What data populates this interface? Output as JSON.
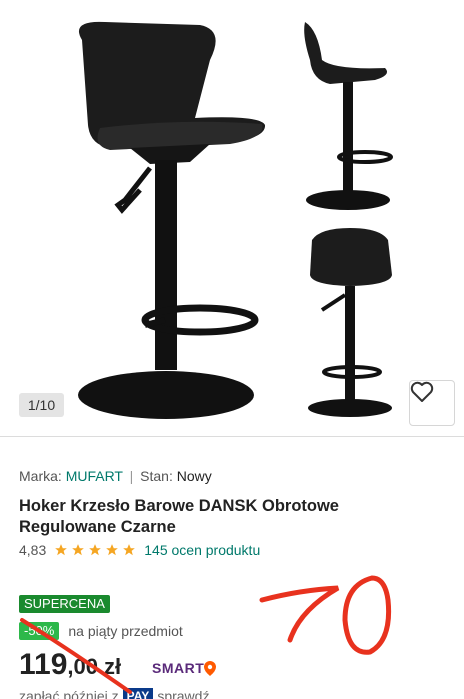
{
  "gallery": {
    "counter": "1/10",
    "favorite_icon": "heart-icon"
  },
  "product": {
    "brand_label": "Marka:",
    "brand": "MUFART",
    "separator": "|",
    "state_label": "Stan:",
    "state": "Nowy",
    "title": "Hoker Krzesło Barowe DANSK Obrotowe Regulowane Czarne",
    "rating": "4,83",
    "stars": 5,
    "reviews": "145 ocen produktu"
  },
  "pricing": {
    "super_badge": "SUPERCENA",
    "discount_badge": "-50%",
    "discount_text": "na piąty przedmiot",
    "price_integer": "119",
    "price_decimal": ",00",
    "currency": "zł",
    "smart_label": "SMART",
    "pay_prefix": "zapłać później z",
    "pay_badge": "PAY",
    "pay_suffix": "sprawdź"
  },
  "annotation": {
    "handwritten": "70",
    "color": "#e8321e"
  },
  "colors": {
    "accent_green": "#00796b",
    "badge_green": "#1a8a2e",
    "discount_green": "#2db84a",
    "star": "#f5a623"
  }
}
